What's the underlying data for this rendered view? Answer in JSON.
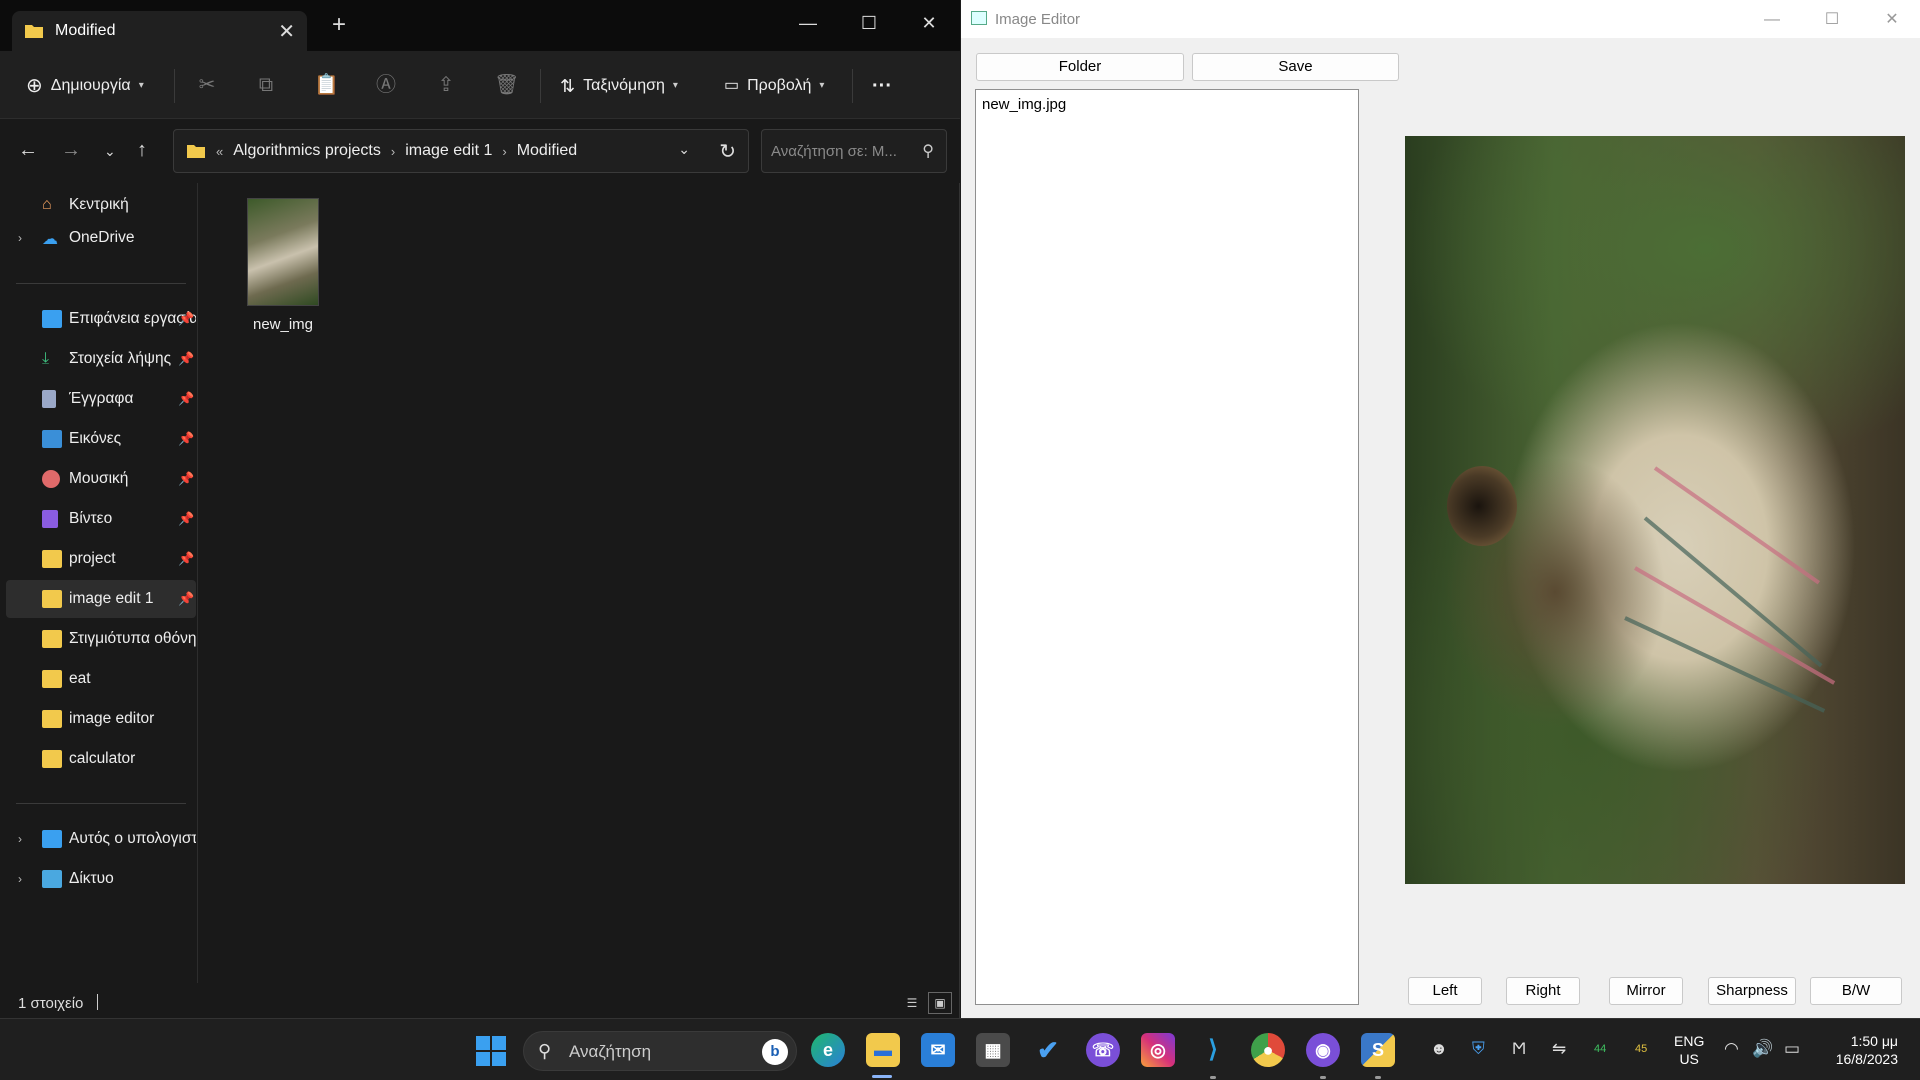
{
  "explorer": {
    "tab_title": "Modified",
    "toolbar": {
      "new_label": "Δημιουργία",
      "sort_label": "Ταξινόμηση",
      "view_label": "Προβολή",
      "more_label": "···"
    },
    "breadcrumbs": [
      "Algorithmics projects",
      "image edit 1",
      "Modified"
    ],
    "breadcrumb_prefix": "«",
    "search_placeholder": "Αναζήτηση σε: M...",
    "sidebar": {
      "home": "Κεντρική",
      "onedrive": "OneDrive",
      "pinned": [
        {
          "label": "Επιφάνεια εργασίας",
          "icon": "desktop-icon",
          "pinned": true
        },
        {
          "label": "Στοιχεία λήψης",
          "icon": "download-icon",
          "pinned": true
        },
        {
          "label": "Έγγραφα",
          "icon": "document-icon",
          "pinned": true
        },
        {
          "label": "Εικόνες",
          "icon": "pictures-icon",
          "pinned": true
        },
        {
          "label": "Μουσική",
          "icon": "music-icon",
          "pinned": true
        },
        {
          "label": "Βίντεο",
          "icon": "video-icon",
          "pinned": true
        },
        {
          "label": "project",
          "icon": "folder-icon",
          "pinned": true
        },
        {
          "label": "image edit 1",
          "icon": "folder-icon",
          "pinned": true,
          "selected": true
        },
        {
          "label": "Στιγμιότυπα οθόνης",
          "icon": "folder-icon",
          "pinned": false
        },
        {
          "label": "eat",
          "icon": "folder-icon",
          "pinned": false
        },
        {
          "label": "image editor",
          "icon": "folder-icon",
          "pinned": false
        },
        {
          "label": "calculator",
          "icon": "folder-icon",
          "pinned": false
        }
      ],
      "this_pc": "Αυτός ο υπολογιστής",
      "network": "Δίκτυο"
    },
    "files": [
      {
        "name": "new_img"
      }
    ],
    "status_count": "1 στοιχείο"
  },
  "editor": {
    "title": "Image Editor",
    "folder_button": "Folder",
    "save_button": "Save",
    "file_list": [
      "new_img.jpg"
    ],
    "actions": [
      "Left",
      "Right",
      "Mirror",
      "Sharpness",
      "B/W"
    ]
  },
  "taskbar": {
    "search_label": "Αναζήτηση",
    "apps": [
      "edge-icon",
      "file-explorer-icon",
      "mail-icon",
      "calculator-icon",
      "todo-icon",
      "viber-icon",
      "instagram-icon",
      "vscode-icon",
      "chrome-icon",
      "github-desktop-icon",
      "python-icon"
    ],
    "tray": {
      "temp1": "44",
      "temp2": "45"
    },
    "language": "ENG",
    "region": "US",
    "time": "1:50 μμ",
    "date": "16/8/2023"
  },
  "colors": {
    "explorer_bg": "#191919",
    "editor_bg": "#f0f0f0",
    "folder_yellow": "#f2c94c",
    "accent_blue": "#3aa0f0"
  }
}
